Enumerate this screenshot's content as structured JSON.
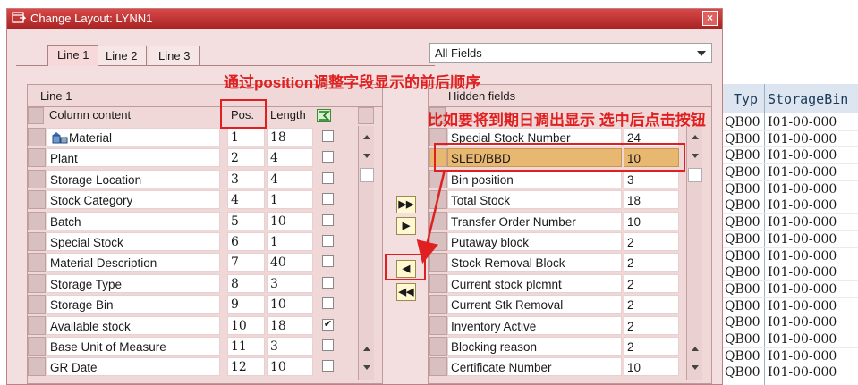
{
  "dialog": {
    "title": "Change Layout: LYNN1",
    "close_glyph": "×",
    "tabs": [
      {
        "label": "Line 1",
        "active": true
      },
      {
        "label": "Line 2",
        "active": false
      },
      {
        "label": "Line 3",
        "active": false
      }
    ],
    "fields_select": {
      "value": "All Fields"
    },
    "left_panel": {
      "title": "Line 1",
      "headers": {
        "column_content": "Column content",
        "pos": "Pos.",
        "length": "Length"
      },
      "rows": [
        {
          "name": "Material",
          "pos": "1",
          "len": "18",
          "checked": false,
          "icon": "material-icon"
        },
        {
          "name": "Plant",
          "pos": "2",
          "len": "4",
          "checked": false
        },
        {
          "name": "Storage Location",
          "pos": "3",
          "len": "4",
          "checked": false
        },
        {
          "name": "Stock Category",
          "pos": "4",
          "len": "1",
          "checked": false
        },
        {
          "name": "Batch",
          "pos": "5",
          "len": "10",
          "checked": false
        },
        {
          "name": "Special Stock",
          "pos": "6",
          "len": "1",
          "checked": false
        },
        {
          "name": "Material Description",
          "pos": "7",
          "len": "40",
          "checked": false
        },
        {
          "name": "Storage Type",
          "pos": "8",
          "len": "3",
          "checked": false
        },
        {
          "name": "Storage Bin",
          "pos": "9",
          "len": "10",
          "checked": false
        },
        {
          "name": "Available stock",
          "pos": "10",
          "len": "18",
          "checked": true
        },
        {
          "name": "Base Unit of Measure",
          "pos": "11",
          "len": "3",
          "checked": false
        },
        {
          "name": "GR Date",
          "pos": "12",
          "len": "10",
          "checked": false
        }
      ]
    },
    "right_panel": {
      "title": "Hidden fields",
      "rows": [
        {
          "name": "Special Stock Number",
          "len": "24"
        },
        {
          "name": "SLED/BBD",
          "len": "10",
          "highlighted": true
        },
        {
          "name": "Bin position",
          "len": "3"
        },
        {
          "name": "Total Stock",
          "len": "18"
        },
        {
          "name": "Transfer Order Number",
          "len": "10"
        },
        {
          "name": "Putaway block",
          "len": "2"
        },
        {
          "name": "Stock Removal Block",
          "len": "2"
        },
        {
          "name": "Current stock plcmnt",
          "len": "2"
        },
        {
          "name": "Current Stk Removal",
          "len": "2"
        },
        {
          "name": "Inventory Active",
          "len": "2"
        },
        {
          "name": "Blocking reason",
          "len": "2"
        },
        {
          "name": "Certificate Number",
          "len": "10"
        }
      ]
    },
    "move_buttons": [
      {
        "glyph": "▶▶",
        "name": "move-all-right-button"
      },
      {
        "glyph": "▶",
        "name": "move-right-button"
      },
      {
        "glyph": "◀",
        "name": "move-left-button"
      },
      {
        "glyph": "◀◀",
        "name": "move-all-left-button"
      }
    ]
  },
  "annotations": {
    "top": "通过position调整字段显示的前后顺序",
    "right": "比如要将到期日调出显示 选中后点击按钮",
    "color": "#e02020"
  },
  "background_table": {
    "headers": [
      "Typ",
      "StorageBin"
    ],
    "rows": [
      [
        "QB00",
        "I01-00-000"
      ],
      [
        "QB00",
        "I01-00-000"
      ],
      [
        "QB00",
        "I01-00-000"
      ],
      [
        "QB00",
        "I01-00-000"
      ],
      [
        "QB00",
        "I01-00-000"
      ],
      [
        "QB00",
        "I01-00-000"
      ],
      [
        "QB00",
        "I01-00-000"
      ],
      [
        "QB00",
        "I01-00-000"
      ],
      [
        "QB00",
        "I01-00-000"
      ],
      [
        "QB00",
        "I01-00-000"
      ],
      [
        "QB00",
        "I01-00-000"
      ],
      [
        "QB00",
        "I01-00-000"
      ],
      [
        "QB00",
        "I01-00-000"
      ],
      [
        "QB00",
        "I01-00-000"
      ],
      [
        "QB00",
        "I01-00-000"
      ],
      [
        "QB00",
        "I01-00-000"
      ]
    ]
  }
}
